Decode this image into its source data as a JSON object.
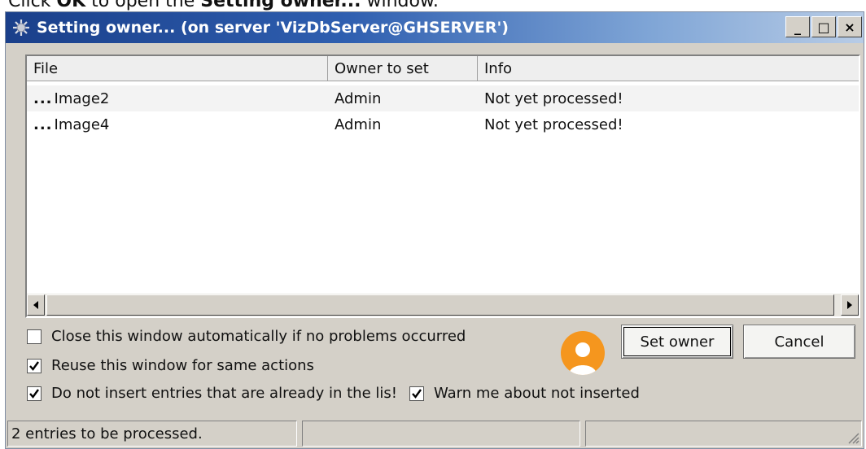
{
  "caption": {
    "pre": "Click ",
    "bold1": "OK",
    "mid": " to open the ",
    "bold2": "Setting owner...",
    "post": " window."
  },
  "window": {
    "title": "Setting owner... (on server 'VizDbServer@GHSERVER')",
    "controls": {
      "minimize": "_",
      "maximize": "□",
      "close": "×"
    }
  },
  "list": {
    "columns": [
      "File",
      "Owner to set",
      "Info"
    ],
    "rows": [
      {
        "dots": "...",
        "file": "Image2",
        "owner": "Admin",
        "info": "Not yet processed!"
      },
      {
        "dots": "...",
        "file": "Image4",
        "owner": "Admin",
        "info": "Not yet processed!"
      }
    ]
  },
  "options": {
    "close_auto": {
      "label": "Close this window automatically if no problems occurred",
      "checked": false
    },
    "reuse": {
      "label": "Reuse this window for same actions",
      "checked": true
    },
    "no_dup": {
      "label": "Do not insert entries that are already in the lis!",
      "checked": true
    },
    "warn": {
      "label": "Warn me about not inserted",
      "checked": true
    }
  },
  "buttons": {
    "set_owner": "Set owner",
    "cancel": "Cancel"
  },
  "status": {
    "text": "2 entries to be processed."
  },
  "icons": {
    "app": "gear-icon",
    "owner": "user-avatar-icon",
    "scroll_left": "arrow-left-icon",
    "scroll_right": "arrow-right-icon",
    "check": "checkmark-icon",
    "grip": "size-grip-icon"
  },
  "colors": {
    "avatar": "#f5961e",
    "title_start": "#1a3f8a",
    "title_end": "#b8cce6"
  }
}
